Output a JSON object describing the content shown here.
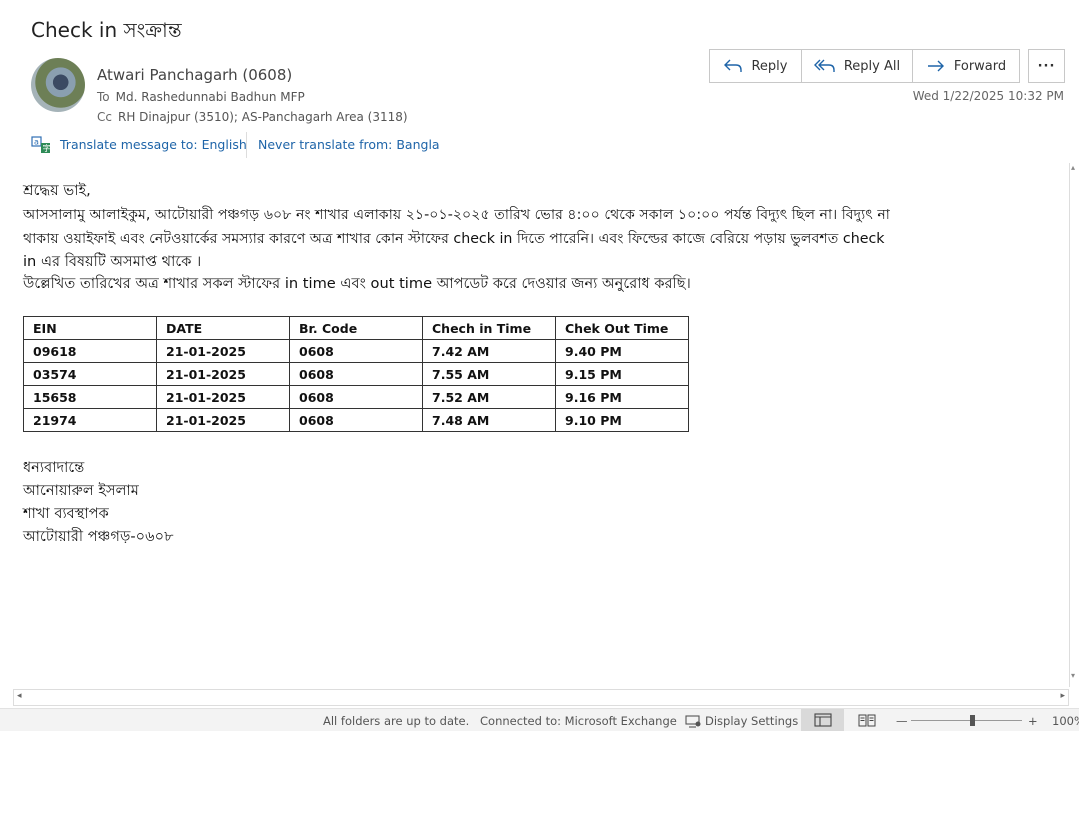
{
  "email": {
    "subject": "Check in সংক্রান্ত",
    "sender": "Atwari Panchagarh (0608)",
    "to_label": "To",
    "to": "Md. Rashedunnabi Badhun MFP",
    "cc_label": "Cc",
    "cc": "RH Dinajpur (3510); AS-Panchagarh Area (3118)",
    "date": "Wed 1/22/2025 10:32 PM"
  },
  "actions": {
    "reply": "Reply",
    "reply_all": "Reply All",
    "forward": "Forward",
    "more": "···"
  },
  "translate": {
    "translate_label": "Translate message to: English",
    "never_label": "Never translate from: Bangla"
  },
  "body": {
    "greeting": "শ্রদ্ধেয় ভাই,",
    "line1": "আসসালামু আলাইকুম, আটোয়ারী পঞ্চগড় ৬০৮ নং শাখার  এলাকায় ২১-০১-২০২৫ তারিখ ভোর ৪:০০ থেকে সকাল ১০:০০ পর্যন্ত বিদ্যুৎ ছিল না। বিদ্যুৎ না",
    "line2": "থাকায় ওয়াইফাই এবং নেটওয়ার্কের সমস্যার কারণে অত্র শাখার কোন স্টাফের check in  দিতে পারেনি। এবং ফিল্ডের কাজে বেরিয়ে পড়ায় ভুলবশত check",
    "line3": "in এর বিষয়টি অসমাপ্ত থাকে ।",
    "line4": "উল্লেখিত তারিখের অত্র শাখার সকল স্টাফের in time এবং out time আপডেট করে দেওয়ার জন্য অনুরোধ করছি।",
    "table": {
      "headers": [
        "EIN",
        "DATE",
        "Br. Code",
        "Chech in Time",
        "Chek Out Time"
      ],
      "rows": [
        [
          "09618",
          "21-01-2025",
          "0608",
          "7.42 AM",
          "9.40 PM"
        ],
        [
          "03574",
          "21-01-2025",
          "0608",
          "7.55 AM",
          "9.15 PM"
        ],
        [
          "15658",
          "21-01-2025",
          "0608",
          "7.52 AM",
          "9.16 PM"
        ],
        [
          "21974",
          "21-01-2025",
          "0608",
          "7.48 AM",
          "9.10 PM"
        ]
      ]
    },
    "signoff": "ধন্যবাদান্তে",
    "name": "আনোয়ারুল ইসলাম",
    "title": "শাখা ব্যবস্থাপক",
    "branch": "আটোয়ারী পঞ্চগড়-০৬০৮"
  },
  "status": {
    "folders": "All folders are up to date.",
    "connection": "Connected to: Microsoft Exchange",
    "display_settings": "Display Settings",
    "zoom_minus": "—",
    "zoom_plus": "+",
    "zoom": "100%",
    "zoom_level": 0.55
  },
  "colors": {
    "link": "#1e64a8",
    "accent": "#1e64a8"
  }
}
